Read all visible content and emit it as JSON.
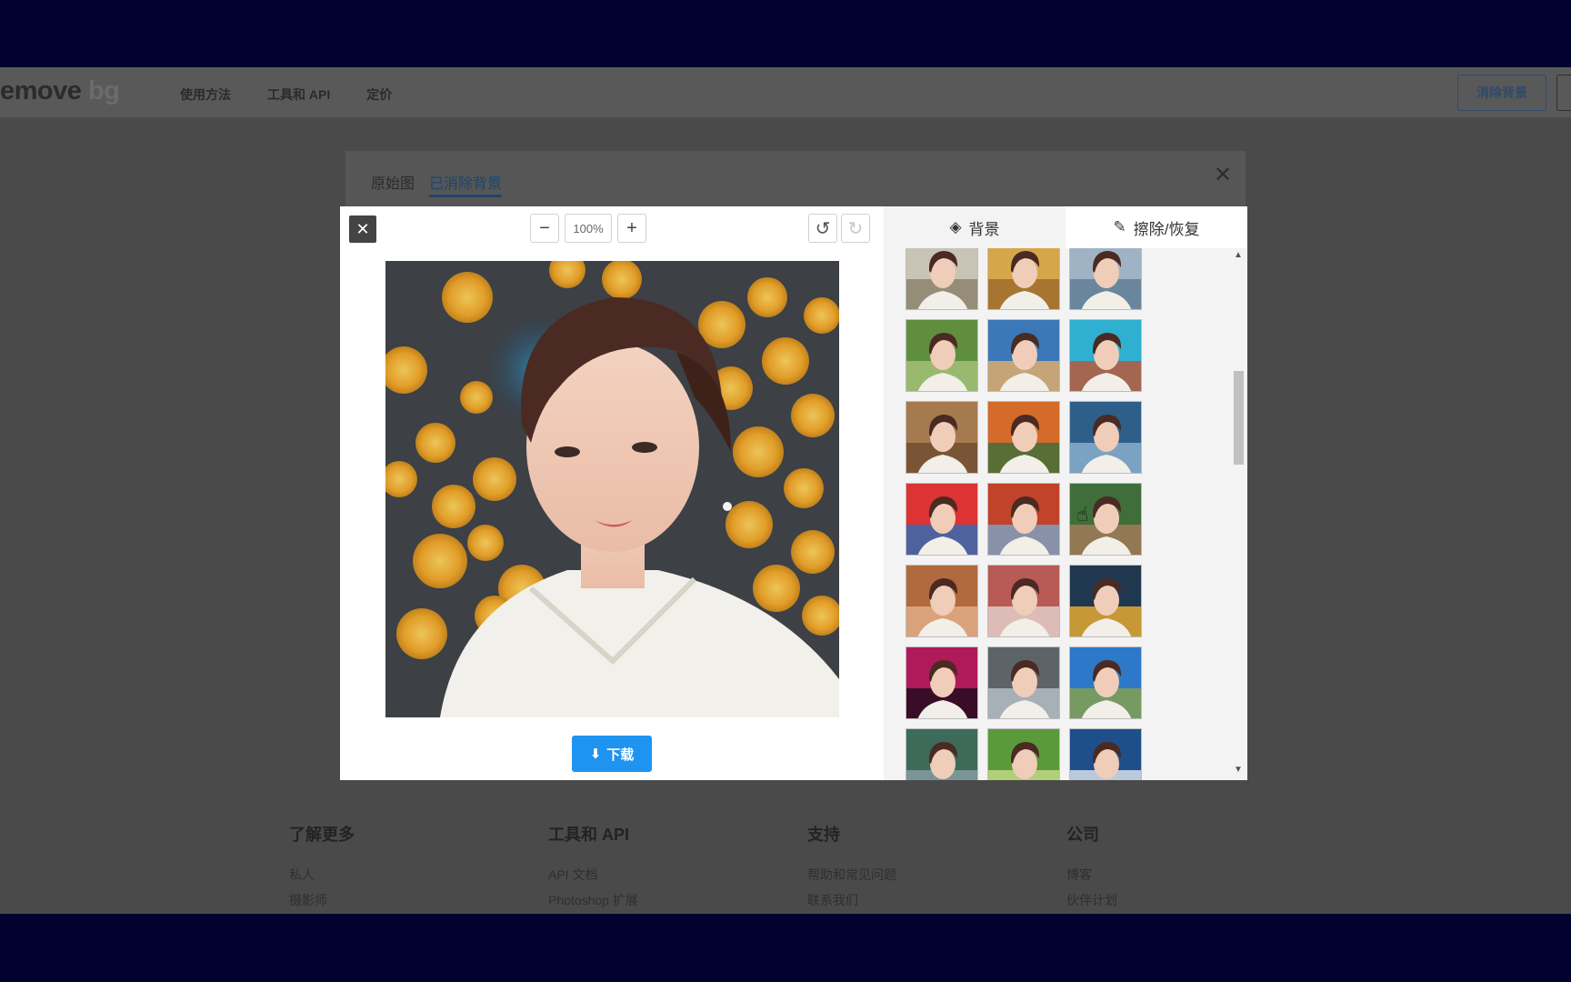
{
  "site": {
    "logo_main": "emove",
    "logo_suffix": "bg",
    "nav": [
      "使用方法",
      "工具和 API",
      "定价"
    ],
    "header_button": "消除背景",
    "bg_tabs": [
      "原始图",
      "已消除背景"
    ],
    "footer": [
      {
        "title": "了解更多",
        "links": [
          "私人",
          "摄影师"
        ]
      },
      {
        "title": "工具和 API",
        "links": [
          "API 文档",
          "Photoshop 扩展"
        ]
      },
      {
        "title": "支持",
        "links": [
          "帮助和常见问题",
          "联系我们"
        ]
      },
      {
        "title": "公司",
        "links": [
          "博客",
          "伙伴计划"
        ]
      }
    ]
  },
  "editor": {
    "zoom_value": "100%",
    "download_label": "下载"
  },
  "side": {
    "tab_background": "背景",
    "tab_erase": "擦除/恢复"
  },
  "colors": {
    "accent": "#1f93f0",
    "overlay": "#4a4a4a",
    "letterbox": "#02022f"
  }
}
